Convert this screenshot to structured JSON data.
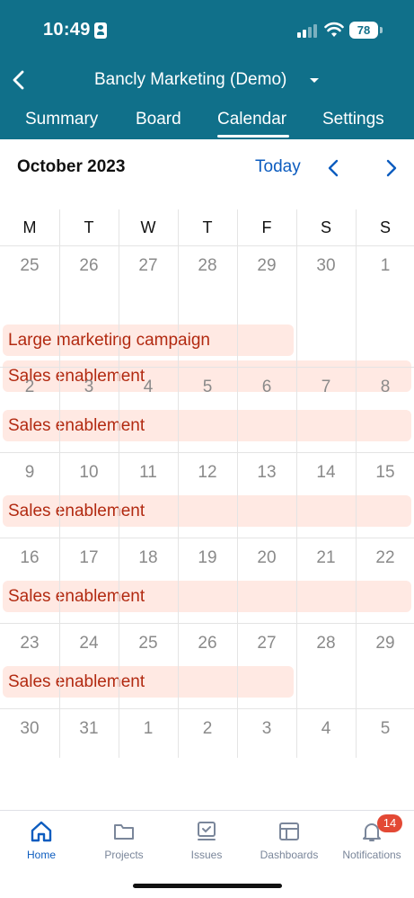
{
  "status_bar": {
    "time": "10:49",
    "battery": "78"
  },
  "header": {
    "title": "Bancly Marketing (Demo)",
    "tabs": [
      {
        "label": "Summary"
      },
      {
        "label": "Board"
      },
      {
        "label": "Calendar"
      },
      {
        "label": "Settings"
      }
    ],
    "active_tab": "Calendar"
  },
  "calendar": {
    "month_label": "October 2023",
    "today_label": "Today",
    "weekdays": [
      "M",
      "T",
      "W",
      "T",
      "F",
      "S",
      "S"
    ],
    "weeks": [
      {
        "days": [
          "25",
          "26",
          "27",
          "28",
          "29",
          "30",
          "1"
        ],
        "events": [
          {
            "title": "Large marketing campaign"
          },
          {
            "title": "Sales enablement"
          }
        ]
      },
      {
        "days": [
          "2",
          "3",
          "4",
          "5",
          "6",
          "7",
          "8"
        ],
        "events": [
          {
            "title": "Sales enablement"
          }
        ]
      },
      {
        "days": [
          "9",
          "10",
          "11",
          "12",
          "13",
          "14",
          "15"
        ],
        "events": [
          {
            "title": "Sales enablement"
          }
        ]
      },
      {
        "days": [
          "16",
          "17",
          "18",
          "19",
          "20",
          "21",
          "22"
        ],
        "events": [
          {
            "title": "Sales enablement"
          }
        ]
      },
      {
        "days": [
          "23",
          "24",
          "25",
          "26",
          "27",
          "28",
          "29"
        ],
        "events": [
          {
            "title": "Sales enablement"
          }
        ]
      },
      {
        "days": [
          "30",
          "31",
          "1",
          "2",
          "3",
          "4",
          "5"
        ],
        "events": []
      }
    ]
  },
  "bottom_nav": {
    "items": [
      {
        "label": "Home",
        "icon": "home-icon"
      },
      {
        "label": "Projects",
        "icon": "folder-icon"
      },
      {
        "label": "Issues",
        "icon": "issues-icon"
      },
      {
        "label": "Dashboards",
        "icon": "dashboard-icon"
      },
      {
        "label": "Notifications",
        "icon": "bell-icon"
      }
    ],
    "active": "Home",
    "notifications_badge": "14"
  },
  "colors": {
    "header_bg": "#10708a",
    "accent": "#0c5cbf",
    "event_bg": "#ffe9e3",
    "event_text": "#b22a11",
    "badge": "#e34935"
  }
}
